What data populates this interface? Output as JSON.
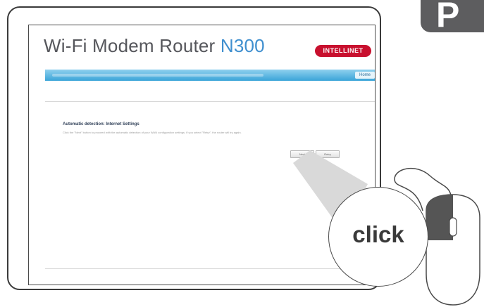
{
  "window": {
    "title_prefix": "Wi-Fi Modem Router ",
    "title_model": "N300",
    "brand": "INTELLINET"
  },
  "nav": {
    "link": "Home"
  },
  "content": {
    "heading": "Automatic detection: Internet Settings",
    "description": "Click the \"Next\" button to proceed with the automatic detection of your WAN configuration settings. If you select \"Retry\", the router will try again.",
    "buttons": {
      "next": "Next",
      "retry": "Retry"
    }
  },
  "callout": {
    "label": "click"
  },
  "page_tab": {
    "letter": "P"
  },
  "colors": {
    "nav_blue": "#3aa4d8",
    "brand_red": "#c8102e",
    "tab_gray": "#5d5d5f"
  }
}
